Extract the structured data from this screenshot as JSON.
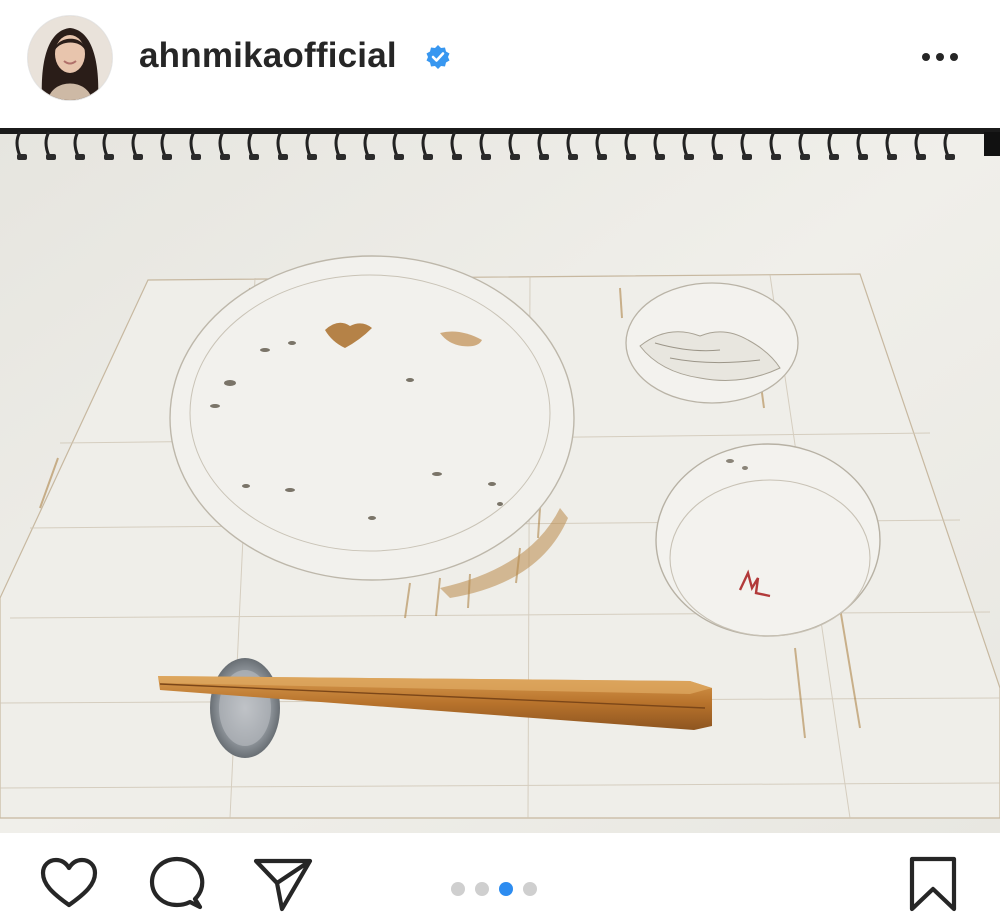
{
  "post": {
    "username": "ahnmikaofficial",
    "verified": true,
    "avatar": "profile-photo",
    "photo": "watercolor-sketch-of-table-setting-with-chopsticks",
    "carousel": {
      "total": 4,
      "active_index": 2
    }
  },
  "icons": {
    "verified": "verified-badge-icon",
    "more": "more-options-icon",
    "like": "heart-icon",
    "comment": "comment-icon",
    "share": "paper-plane-icon",
    "save": "bookmark-icon"
  },
  "colors": {
    "verified": "#3897f0",
    "dot_active": "#2d8cf0",
    "dot_inactive": "#cfcfcf",
    "text": "#262626"
  }
}
